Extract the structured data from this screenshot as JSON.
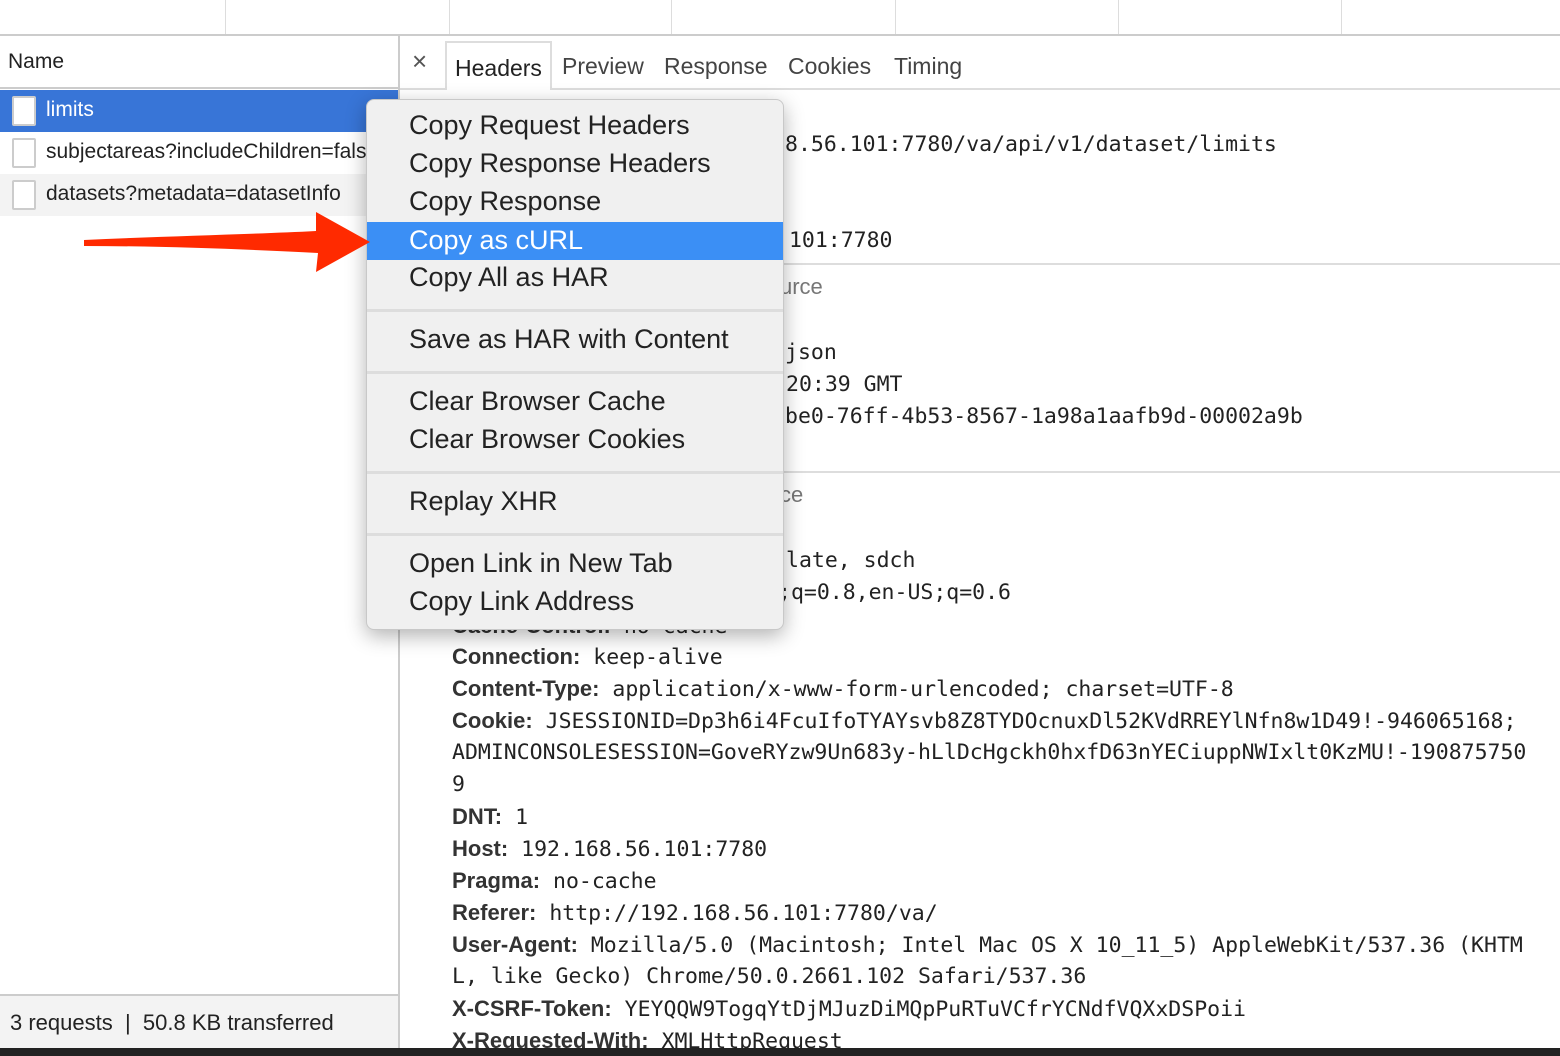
{
  "network_list": {
    "column_header": "Name",
    "requests": [
      {
        "name": "limits",
        "selected": true
      },
      {
        "name": "subjectareas?includeChildren=fals"
      },
      {
        "name": "datasets?metadata=datasetInfo"
      }
    ],
    "footer": {
      "requests": "3 requests",
      "divider": "|",
      "transferred": "50.8 KB transferred"
    }
  },
  "detail": {
    "close_icon": "×",
    "tabs": [
      "Headers",
      "Preview",
      "Response",
      "Cookies",
      "Timing"
    ],
    "active_tab": "Headers",
    "visible_fragments": [
      "8.56.101:7780/va/api/v1/dataset/limits",
      ".101:7780",
      "urce",
      "json",
      "20:39 GMT",
      "be0-76ff-4b53-8567-1a98a1aafb9d-00002a9b",
      "ce",
      "late, sdch",
      ";q=0.8,en-US;q=0.6"
    ],
    "cache_control": {
      "key": "Cache-Control:",
      "value": "no-cache"
    },
    "headers": [
      {
        "key": "Connection:",
        "value": "keep-alive"
      },
      {
        "key": "Content-Type:",
        "value": "application/x-www-form-urlencoded; charset=UTF-8"
      },
      {
        "key": "Cookie:",
        "value": "JSESSIONID=Dp3h6i4FcuIfoTYAYsvb8Z8TYDOcnuxDl52KVdRREYlNfn8w1D49!-946065168;"
      },
      {
        "key": "",
        "value": "ADMINCONSOLESESSION=GoveRYzw9Un683y-hLlDcHgckh0hxfD63nYECiuppNWIxlt0KzMU!-190875750"
      },
      {
        "key": "",
        "value": "9"
      },
      {
        "key": "DNT:",
        "value": "1"
      },
      {
        "key": "Host:",
        "value": "192.168.56.101:7780"
      },
      {
        "key": "Pragma:",
        "value": "no-cache"
      },
      {
        "key": "Referer:",
        "value": "http://192.168.56.101:7780/va/"
      },
      {
        "key": "User-Agent:",
        "value": "Mozilla/5.0 (Macintosh; Intel Mac OS X 10_11_5) AppleWebKit/537.36 (KHTM"
      },
      {
        "key": "",
        "value": "L, like Gecko) Chrome/50.0.2661.102 Safari/537.36"
      },
      {
        "key": "X-CSRF-Token:",
        "value": "YEYQQW9TogqYtDjMJuzDiMQpPuRTuVCfrYCNdfVQXxDSPoii"
      },
      {
        "key": "X-Requested-With:",
        "value": "XMLHttpRequest"
      }
    ]
  },
  "context_menu": {
    "items": [
      "Copy Request Headers",
      "Copy Response Headers",
      "Copy Response",
      "Copy as cURL",
      "Copy All as HAR",
      "Save as HAR with Content",
      "Clear Browser Cache",
      "Clear Browser Cookies",
      "Replay XHR",
      "Open Link in New Tab",
      "Copy Link Address"
    ],
    "highlighted": "Copy as cURL"
  },
  "annotation": {
    "arrow_color": "#ff2a00"
  },
  "colors": {
    "selection": "#3875d7",
    "menu_highlight": "#3b8ff5"
  }
}
